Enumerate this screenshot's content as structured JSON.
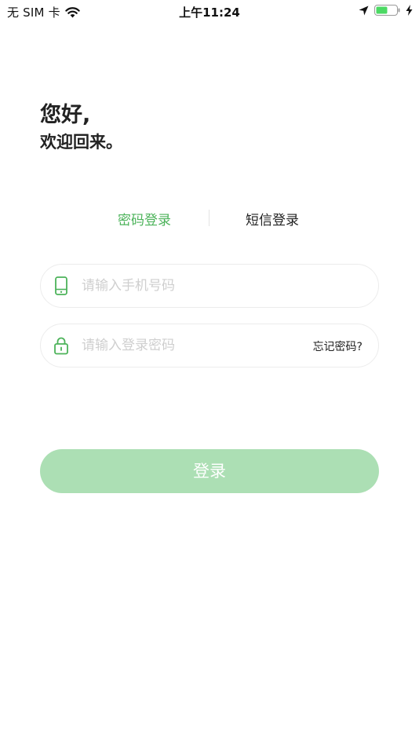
{
  "status_bar": {
    "carrier": "无 SIM 卡",
    "time": "上午11:24",
    "battery_color": "#4cd964"
  },
  "greeting": {
    "hello": "您好,",
    "welcome": "欢迎回来。"
  },
  "tabs": [
    {
      "label": "密码登录",
      "active": true
    },
    {
      "label": "短信登录",
      "active": false
    }
  ],
  "phone_field": {
    "placeholder": "请输入手机号码",
    "icon": "phone-icon"
  },
  "password_field": {
    "placeholder": "请输入登录密码",
    "icon": "lock-icon",
    "forgot_label": "忘记密码?"
  },
  "login_button": {
    "label": "登录"
  },
  "colors": {
    "accent": "#4cb35a",
    "button_disabled": "#acdfb4",
    "placeholder": "#cfcfcf"
  }
}
